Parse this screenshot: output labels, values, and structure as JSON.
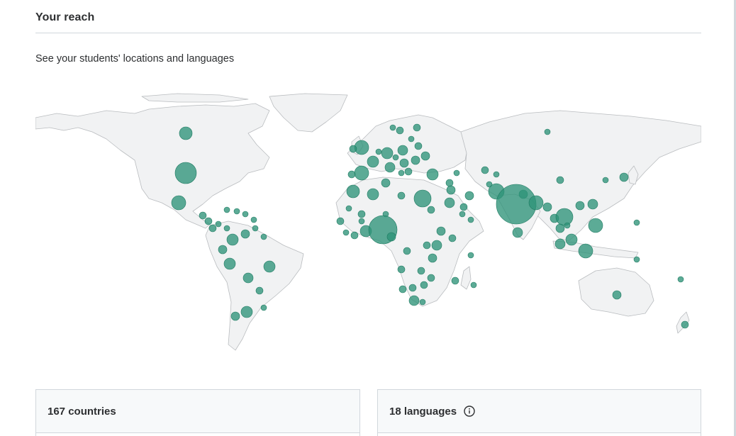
{
  "section": {
    "title": "Your reach",
    "subtitle": "See your students' locations and languages"
  },
  "colors": {
    "land": "#f1f2f3",
    "border": "#b9bcbf",
    "bubble": "#2e9478",
    "divider": "#d1d7dc"
  },
  "cards": {
    "countries_label": "167 countries",
    "languages_label": "18 languages"
  },
  "icons": {
    "info": "info-circle-icon"
  }
}
